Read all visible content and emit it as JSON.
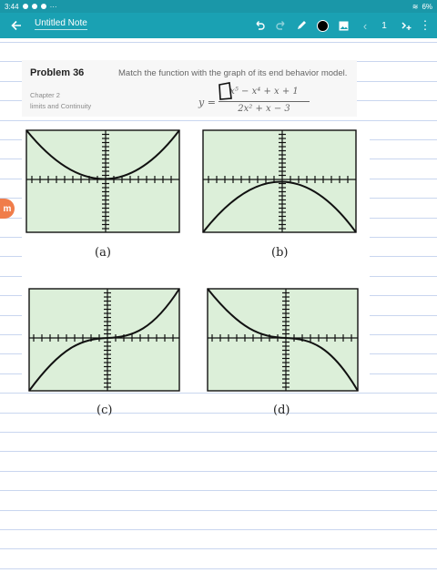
{
  "status": {
    "time": "3:44",
    "battery": "6%"
  },
  "toolbar": {
    "title": "Untitled Note",
    "page_number": "1"
  },
  "problem": {
    "title": "Problem 36",
    "text": "Match the function with the graph of its end behavior model.",
    "chapter": "Chapter 2",
    "section": "limits and Continuity",
    "formula_lhs": "y =",
    "numerator": "x⁵ − x⁴ + x + 1",
    "denominator": "2x² + x − 3"
  },
  "graphs": [
    {
      "caption": "(a)",
      "shape": "up-parabola"
    },
    {
      "caption": "(b)",
      "shape": "down-parabola"
    },
    {
      "caption": "(c)",
      "shape": "increasing-cubic"
    },
    {
      "caption": "(d)",
      "shape": "decreasing-cubic"
    }
  ],
  "colors": {
    "statusbar": "#1a97a8",
    "toolbar": "#1aa1b3",
    "graph_fill": "#dcefd9",
    "rule": "#c9d6ef"
  },
  "badge": {
    "label": "m"
  }
}
